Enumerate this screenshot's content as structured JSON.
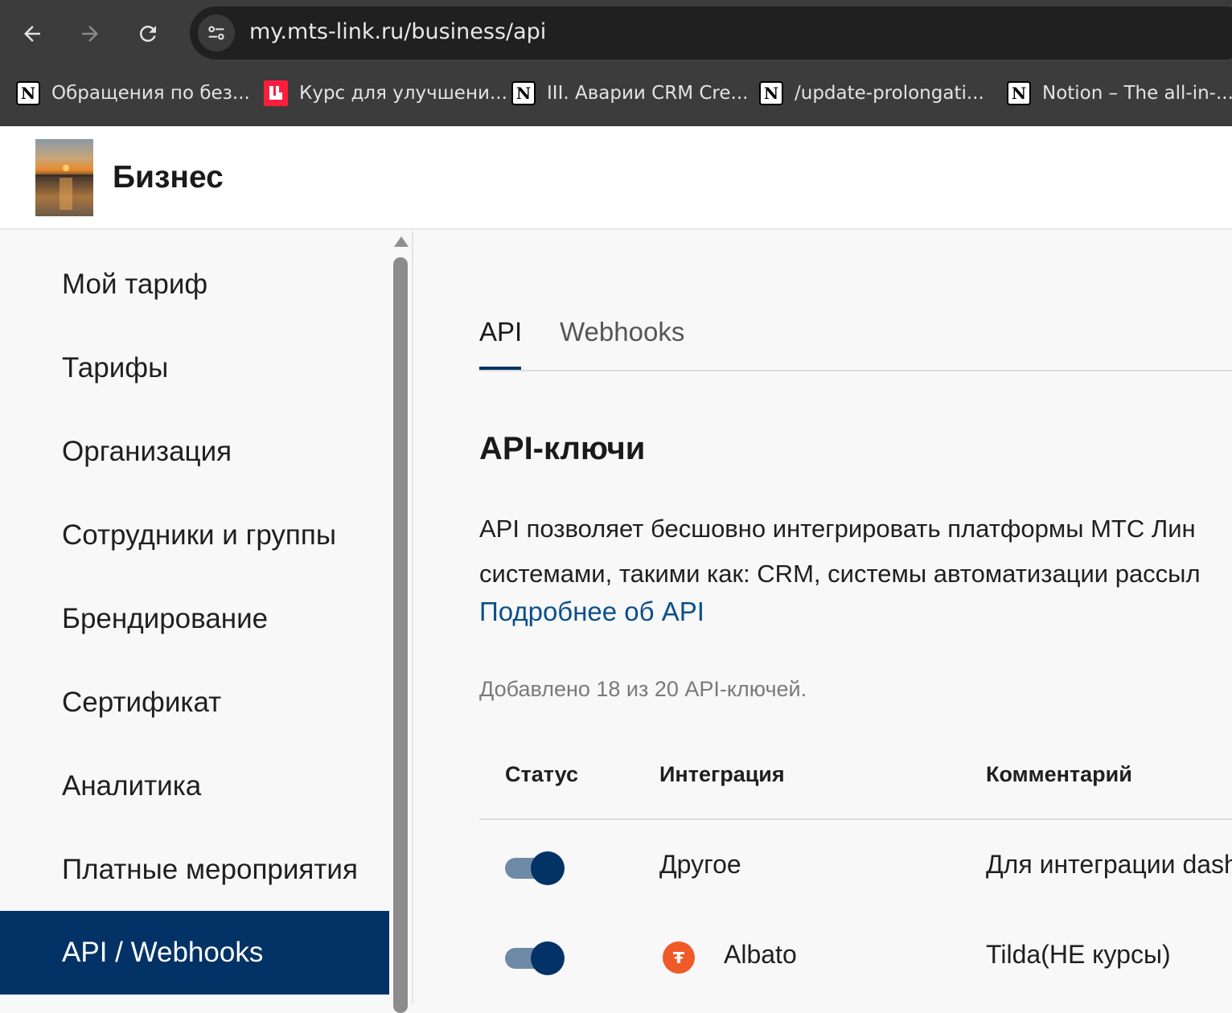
{
  "browser": {
    "url": "my.mts-link.ru/business/api",
    "bookmarks": [
      {
        "label": "Обращения по без...",
        "icon": "notion-icon"
      },
      {
        "label": "Курс для улучшени...",
        "icon": "red-l-icon"
      },
      {
        "label": "III. Аварии CRM Cre...",
        "icon": "notion-icon"
      },
      {
        "label": "/update-prolongati...",
        "icon": "notion-icon"
      },
      {
        "label": "Notion – The all-in-...",
        "icon": "notion-icon"
      }
    ]
  },
  "header": {
    "title": "Бизнес"
  },
  "sidebar": {
    "items": [
      {
        "label": "Мой тариф"
      },
      {
        "label": "Тарифы"
      },
      {
        "label": "Организация"
      },
      {
        "label": "Сотрудники и группы"
      },
      {
        "label": "Брендирование"
      },
      {
        "label": "Сертификат"
      },
      {
        "label": "Аналитика"
      },
      {
        "label": "Платные мероприятия"
      },
      {
        "label": "API / Webhooks",
        "active": true
      }
    ]
  },
  "main": {
    "tabs": [
      {
        "label": "API",
        "active": true
      },
      {
        "label": "Webhooks",
        "active": false
      }
    ],
    "section_title": "API-ключи",
    "description_line1": "API позволяет бесшовно интегрировать платформы МТС Лин",
    "description_line2": "системами, такими как: CRM, системы автоматизации рассыл",
    "more_link": "Подробнее об API",
    "count_text": "Добавлено 18 из 20 API-ключей.",
    "table": {
      "columns": [
        "Статус",
        "Интеграция",
        "Комментарий"
      ],
      "rows": [
        {
          "status_on": true,
          "integration": "Другое",
          "comment": "Для интеграции dash"
        },
        {
          "status_on": true,
          "integration": "Albato",
          "integration_icon": "albato-icon",
          "comment": "Tilda(НЕ курсы)"
        }
      ]
    }
  },
  "colors": {
    "accent": "#033366",
    "link": "#0b4f8a",
    "chrome_bg": "#3c3c3c",
    "albato": "#f05a28"
  }
}
